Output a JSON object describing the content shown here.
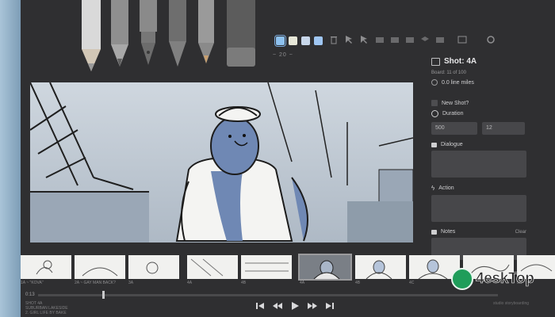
{
  "toolbar": {
    "brush_size": "~ 20 ~",
    "swatches": [
      "#8ec2f0",
      "#e7e7d8",
      "#c8d7ea",
      "#9fc6f2"
    ],
    "tools": [
      "light-pencil",
      "pencil",
      "pen",
      "brush",
      "note-pen",
      "eraser"
    ]
  },
  "panel": {
    "shot_title": "Shot: 4A",
    "board_count": "Board: 11 of 100",
    "line_miles": "0.0 line miles",
    "new_shot_label": "New Shot?",
    "duration_label": "Duration",
    "duration_ms": "500",
    "duration_frames": "12",
    "dialogue_label": "Dialogue",
    "action_label": "Action",
    "notes_label": "Notes",
    "clear_label": "Clear"
  },
  "filmstrip": {
    "current_index": 5,
    "labels": [
      "1A  ~ \"KOVA\"",
      "2A  ~ GAY MAN BACK?",
      "3A",
      "4A",
      "4B",
      "4A",
      "4B",
      "4C",
      "4D",
      "5A"
    ]
  },
  "timeline": {
    "time": "0:13",
    "notes": [
      "SHOT 4A",
      "SUBURBAN LAKESIDE",
      "2. GIRL LIFE BY BAKE"
    ],
    "credit": "studio storyboarding",
    "progress": 0.14
  },
  "watermark": {
    "brand": "4eskTop"
  }
}
